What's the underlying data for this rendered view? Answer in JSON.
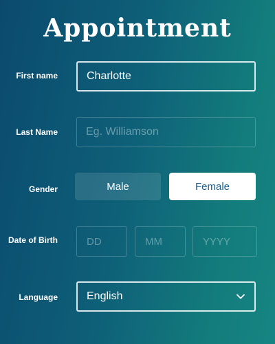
{
  "title": "Appointment",
  "form": {
    "first_name": {
      "label": "First name",
      "value": "Charlotte",
      "placeholder": ""
    },
    "last_name": {
      "label": "Last Name",
      "value": "",
      "placeholder": "Eg. Williamson"
    },
    "gender": {
      "label": "Gender",
      "options": [
        "Male",
        "Female"
      ],
      "selected": "Female"
    },
    "date_of_birth": {
      "label": "Date of Birth",
      "day_placeholder": "DD",
      "month_placeholder": "MM",
      "year_placeholder": "YYYY"
    },
    "language": {
      "label": "Language",
      "selected": "English"
    }
  },
  "colors": {
    "gradient_start": "#0b4a6e",
    "gradient_end": "#168582",
    "selected_text": "#1a5f8e"
  },
  "icons": {
    "language_dropdown": "chevron-down-icon"
  }
}
